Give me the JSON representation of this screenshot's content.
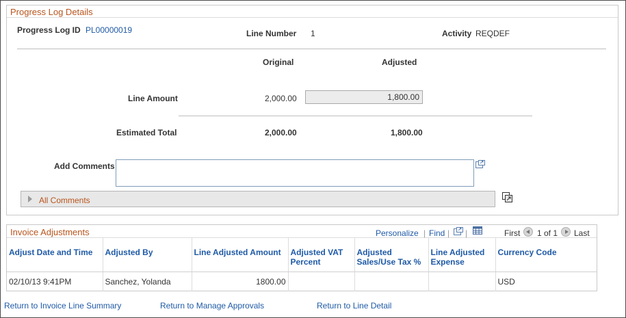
{
  "progress_log": {
    "title": "Progress Log Details",
    "id_label": "Progress Log ID",
    "id_value": "PL00000019",
    "line_number_label": "Line Number",
    "line_number_value": "1",
    "activity_label": "Activity",
    "activity_value": "REQDEF",
    "original_header": "Original",
    "adjusted_header": "Adjusted",
    "line_amount_label": "Line Amount",
    "line_amount_original": "2,000.00",
    "line_amount_adjusted": "1,800.00",
    "estimated_total_label": "Estimated Total",
    "estimated_total_original": "2,000.00",
    "estimated_total_adjusted": "1,800.00",
    "add_comments_label": "Add Comments",
    "comments_value": "",
    "all_comments_label": "All Comments"
  },
  "invoice_adjustments": {
    "title": "Invoice Adjustments",
    "personalize_label": "Personalize",
    "find_label": "Find",
    "first_label": "First",
    "pagination_text": "1 of 1",
    "last_label": "Last",
    "columns": [
      "Adjust Date and Time",
      "Adjusted By",
      "Line Adjusted Amount",
      "Adjusted VAT Percent",
      "Adjusted Sales/Use Tax %",
      "Line Adjusted Expense",
      "Currency Code"
    ],
    "rows": [
      [
        "02/10/13  9:41PM",
        "Sanchez, Yolanda",
        "1800.00",
        "",
        "",
        "",
        "USD"
      ]
    ]
  },
  "footer_links": {
    "return_invoice_line_summary": "Return to Invoice Line Summary",
    "return_manage_approvals": "Return to Manage Approvals",
    "return_line_detail": "Return to Line Detail"
  },
  "colors": {
    "link": "#1f5aa6",
    "group_title": "#b8541c",
    "readonly_bg": "#ececec"
  }
}
